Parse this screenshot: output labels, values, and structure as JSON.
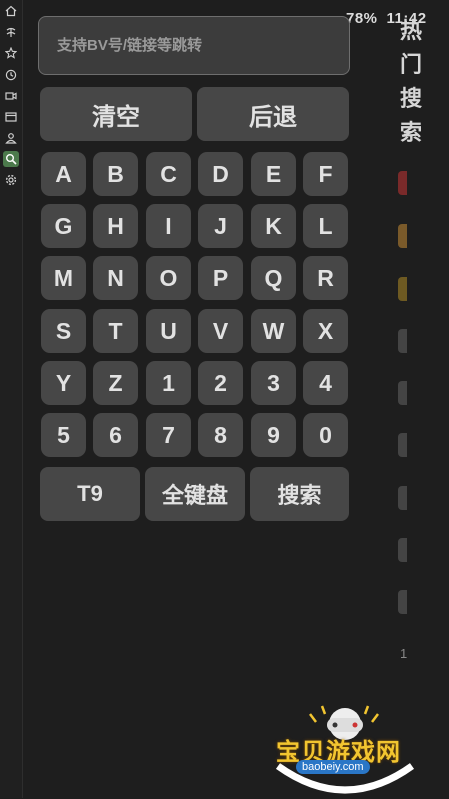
{
  "status": {
    "battery": "78%",
    "time": "11:42"
  },
  "search": {
    "placeholder": "支持BV号/链接等跳转"
  },
  "actions": {
    "clear": "清空",
    "back": "后退"
  },
  "keys": [
    "A",
    "B",
    "C",
    "D",
    "E",
    "F",
    "G",
    "H",
    "I",
    "J",
    "K",
    "L",
    "M",
    "N",
    "O",
    "P",
    "Q",
    "R",
    "S",
    "T",
    "U",
    "V",
    "W",
    "X",
    "Y",
    "Z",
    "1",
    "2",
    "3",
    "4",
    "5",
    "6",
    "7",
    "8",
    "9",
    "0"
  ],
  "bottom": {
    "t9": "T9",
    "full": "全键盘",
    "search": "搜索"
  },
  "hot": {
    "title_chars": [
      "热",
      "门",
      "搜",
      "索"
    ],
    "rank_colors": [
      "#7a2a2a",
      "#7a5a2a",
      "#6e5a22",
      "#444444",
      "#444444",
      "#444444",
      "#444444",
      "#444444",
      "#444444"
    ],
    "last_rank": "1"
  },
  "rail": [
    "home-icon",
    "anime-icon",
    "star-icon",
    "history-icon",
    "video-icon",
    "live-icon",
    "user-icon",
    "search-icon",
    "settings-icon"
  ],
  "watermark": {
    "text": "宝贝游戏网",
    "url": "baobeiy.com"
  }
}
